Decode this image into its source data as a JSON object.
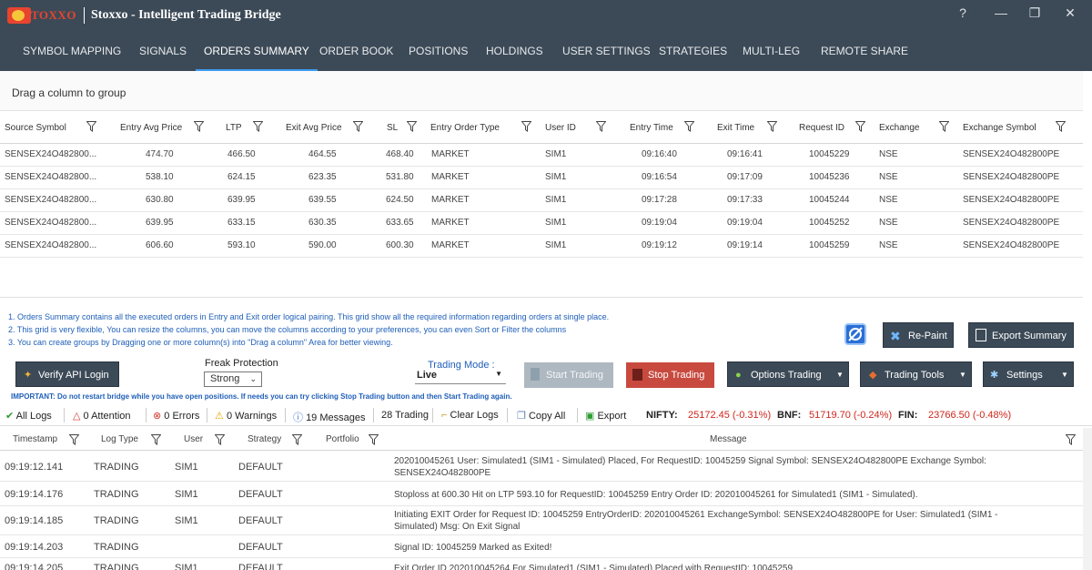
{
  "window": {
    "logo_text": "TOXXO",
    "title": "Stoxxo - Intelligent Trading Bridge",
    "help_label": "?",
    "minimize_label": "—",
    "maximize_label": "❐",
    "close_label": "✕"
  },
  "nav": {
    "items": [
      "SYMBOL MAPPING",
      "SIGNALS",
      "ORDERS SUMMARY",
      "ORDER BOOK",
      "POSITIONS",
      "HOLDINGS",
      "USER SETTINGS",
      "STRATEGIES",
      "MULTI-LEG",
      "REMOTE SHARE"
    ],
    "active": "ORDERS SUMMARY"
  },
  "group_bar": {
    "label": "Drag a column to group"
  },
  "orders_grid": {
    "columns": [
      "Source Symbol",
      "Entry Avg Price",
      "LTP",
      "Exit Avg Price",
      "SL",
      "Entry Order Type",
      "User ID",
      "Entry Time",
      "Exit Time",
      "Request ID",
      "Exchange",
      "Exchange Symbol"
    ],
    "rows": [
      [
        "SENSEX24O482800...",
        "474.70",
        "466.50",
        "464.55",
        "468.40",
        "MARKET",
        "SIM1",
        "09:16:40",
        "09:16:41",
        "10045229",
        "NSE",
        "SENSEX24O482800PE"
      ],
      [
        "SENSEX24O482800...",
        "538.10",
        "624.15",
        "623.35",
        "531.80",
        "MARKET",
        "SIM1",
        "09:16:54",
        "09:17:09",
        "10045236",
        "NSE",
        "SENSEX24O482800PE"
      ],
      [
        "SENSEX24O482800...",
        "630.80",
        "639.95",
        "639.55",
        "624.50",
        "MARKET",
        "SIM1",
        "09:17:28",
        "09:17:33",
        "10045244",
        "NSE",
        "SENSEX24O482800PE"
      ],
      [
        "SENSEX24O482800...",
        "639.95",
        "633.15",
        "630.35",
        "633.65",
        "MARKET",
        "SIM1",
        "09:19:04",
        "09:19:04",
        "10045252",
        "NSE",
        "SENSEX24O482800PE"
      ],
      [
        "SENSEX24O482800...",
        "606.60",
        "593.10",
        "590.00",
        "600.30",
        "MARKET",
        "SIM1",
        "09:19:12",
        "09:19:14",
        "10045259",
        "NSE",
        "SENSEX24O482800PE"
      ]
    ]
  },
  "notes": [
    "1. Orders Summary contains all the executed orders in Entry and Exit order logical pairing. This grid show all the required information regarding orders at single place.",
    "2. This grid is very flexible, You can resize the columns, you can move the columns according to your preferences, you can even Sort or Filter the columns",
    "3. You can create groups by Dragging one or more column(s) into \"Drag a column\" Area for better viewing."
  ],
  "actions": {
    "repaint": "Re-Paint",
    "export_summary": "Export Summary",
    "verify_api": "Verify API Login",
    "freak_protection_label": "Freak Protection",
    "freak_protection_value": "Strong",
    "trading_mode_label": "Trading Mode :",
    "trading_mode_value": "Live",
    "start_trading": "Start Trading",
    "stop_trading": "Stop Trading",
    "options_trading": "Options Trading",
    "trading_tools": "Trading Tools",
    "settings": "Settings",
    "important": "IMPORTANT: Do not restart bridge while you have open positions. If needs you can try clicking Stop Trading button and then Start Trading again."
  },
  "status": {
    "all_logs": "All Logs",
    "attention": "0 Attention",
    "errors": "0 Errors",
    "warnings": "0 Warnings",
    "messages": "19 Messages",
    "trading": "28 Trading",
    "clear_logs": "Clear Logs",
    "copy_all": "Copy All",
    "export": "Export",
    "nifty_label": "NIFTY:",
    "nifty_value": "25172.45 (-0.31%)",
    "bnf_label": "BNF:",
    "bnf_value": "51719.70 (-0.24%)",
    "fin_label": "FIN:",
    "fin_value": "23766.50 (-0.48%)"
  },
  "log_grid": {
    "columns": [
      "Timestamp",
      "Log Type",
      "User",
      "Strategy",
      "Portfolio",
      "Message"
    ],
    "rows": [
      [
        "09:19:12.141",
        "TRADING",
        "SIM1",
        "DEFAULT",
        "",
        "202010045261 User: Simulated1 (SIM1 - Simulated) Placed, For RequestID: 10045259  Signal Symbol: SENSEX24O482800PE  Exchange Symbol: SENSEX24O482800PE"
      ],
      [
        "09:19:14.176",
        "TRADING",
        "SIM1",
        "DEFAULT",
        "",
        "Stoploss at 600.30 Hit on LTP 593.10 for RequestID: 10045259  Entry Order ID: 202010045261  for Simulated1 (SIM1 - Simulated)."
      ],
      [
        "09:19:14.185",
        "TRADING",
        "SIM1",
        "DEFAULT",
        "",
        "Initiating EXIT Order for Request ID: 10045259  EntryOrderID: 202010045261  ExchangeSymbol: SENSEX24O482800PE  for User: Simulated1 (SIM1 - Simulated)  Msg: On Exit Signal"
      ],
      [
        "09:19:14.203",
        "TRADING",
        "",
        "DEFAULT",
        "",
        "Signal ID: 10045259 Marked as Exited!"
      ],
      [
        "09:19:14.205",
        "TRADING",
        "SIM1",
        "DEFAULT",
        "",
        "Exit Order ID 202010045264 For Simulated1 (SIM1 - Simulated) Placed with RequestID: 10045259"
      ]
    ]
  }
}
